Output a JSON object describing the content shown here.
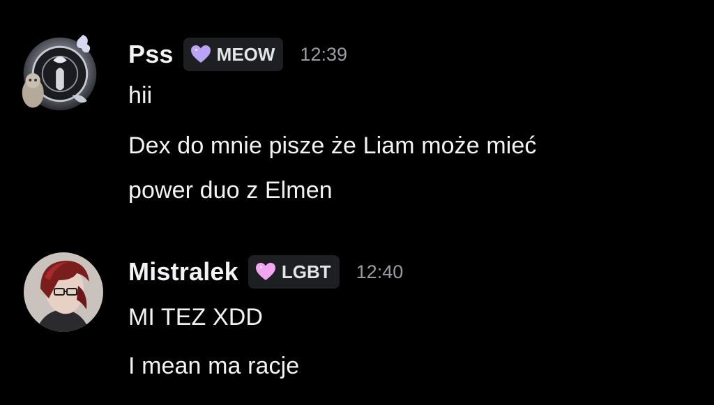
{
  "messages": [
    {
      "author": "Pss",
      "role_tag": "MEOW",
      "role_icon": "purple-heart-icon",
      "timestamp": "12:39",
      "lines": [
        "hii",
        "Dex do mnie pisze że Liam może mieć",
        "power duo z Elmen"
      ]
    },
    {
      "author": "Mistralek",
      "role_tag": "LGBT",
      "role_icon": "pink-heart-icon",
      "timestamp": "12:40",
      "lines": [
        "MI TEZ XDD",
        "I mean ma racje"
      ]
    }
  ],
  "colors": {
    "background": "#000000",
    "text": "#f2f3f5",
    "timestamp": "#9b9ca3",
    "role_tag_bg": "#1e1f22",
    "heart_meow": "#b9a4f5",
    "heart_lgbt": "#f3a6f0"
  }
}
